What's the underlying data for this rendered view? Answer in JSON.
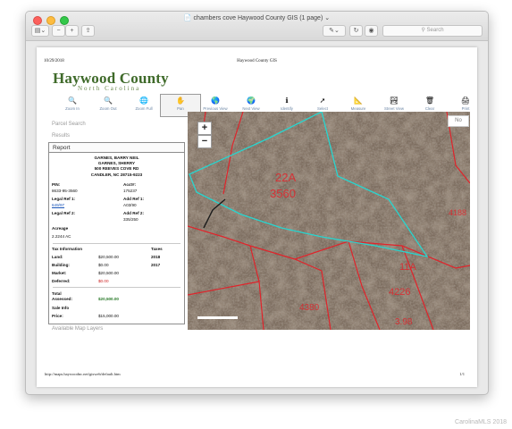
{
  "window": {
    "title": "chambers cove Haywood County GIS (1 page)",
    "search_placeholder": "Search"
  },
  "toolbar_icons": [
    "sidebar-icon",
    "zoom-out-icon",
    "zoom-in-icon",
    "share-icon",
    "markup-icon",
    "rotate-icon",
    "annotate-icon"
  ],
  "page": {
    "date": "10/29/2018",
    "header_title": "Haywood County GIS",
    "footer_url": "http://maps.haywoodnc.net/gisweb/default.htm",
    "page_number": "1/1"
  },
  "logo": {
    "main": "Haywood County",
    "sub": "North Carolina"
  },
  "tools": [
    {
      "label": "Zoom In",
      "icon": "zoom-in-icon",
      "glyph": "🔍"
    },
    {
      "label": "Zoom Out",
      "icon": "zoom-out-icon",
      "glyph": "🔍"
    },
    {
      "label": "Zoom Full",
      "icon": "globe-icon",
      "glyph": "🌐"
    },
    {
      "label": "Pan",
      "icon": "hand-icon",
      "glyph": "✋",
      "active": true
    },
    {
      "label": "Previous View",
      "icon": "previous-view-icon",
      "glyph": "🌎"
    },
    {
      "label": "Next View",
      "icon": "next-view-icon",
      "glyph": "🌍"
    },
    {
      "label": "Identify",
      "icon": "identify-icon",
      "glyph": "ℹ"
    },
    {
      "label": "Select",
      "icon": "select-icon",
      "glyph": "➚"
    },
    {
      "label": "Measure",
      "icon": "measure-icon",
      "glyph": "📐"
    },
    {
      "label": "Street View",
      "icon": "street-view-icon",
      "glyph": "🏞"
    },
    {
      "label": "Clear",
      "icon": "clear-icon",
      "glyph": "🗑"
    },
    {
      "label": "Print",
      "icon": "print-icon",
      "glyph": "🖨"
    }
  ],
  "sidebar": {
    "parcel_search": "Parcel Search",
    "results": "Results",
    "report_tab": "Report",
    "available_layers": "Available Map Layers"
  },
  "report": {
    "owner_1": "GARNES, BARRY NEIL",
    "owner_2": "GARNES, SHERRY",
    "address": "500 REEVES COVE RD",
    "city": "CANDLER, NC 28715-9223",
    "pin_label": "PIN:",
    "pin": "8633-95-3560",
    "acct_label": "Acct#:",
    "acct": "175237",
    "legal_ref1_label": "Legal Ref 1:",
    "legal_ref1": "649/97",
    "add_ref1_label": "Add Ref 1:",
    "add_ref1": "A03/90",
    "legal_ref2_label": "Legal Ref 2:",
    "add_ref2_label": "Add Ref 2:",
    "add_ref2": "335/250",
    "acreage_label": "Acreage",
    "acreage": "2.2244 AC",
    "tax_info_label": "Tax Information",
    "taxes_label": "Taxes",
    "land_label": "Land:",
    "land": "$20,500.00",
    "year_1": "2018",
    "building_label": "Building:",
    "building": "$0.00",
    "year_2": "2017",
    "market_label": "Market:",
    "market": "$20,500.00",
    "deferred_label": "Deferred:",
    "deferred": "$0.00",
    "total_label_1": "Total",
    "total_label_2": "Assessed:",
    "total": "$20,500.00",
    "sale_info_label": "Sale Info",
    "price_label": "Price:",
    "price": "$15,000.00"
  },
  "map": {
    "zoom_in": "+",
    "zoom_out": "−",
    "no_button": "No",
    "labels": [
      {
        "text": "22A",
        "name": "parcel-label-22a"
      },
      {
        "text": "3560",
        "name": "parcel-label-3560"
      },
      {
        "text": "11A",
        "name": "parcel-label-11a"
      },
      {
        "text": "4226",
        "name": "parcel-label-4226"
      },
      {
        "text": "4380",
        "name": "parcel-label-4380"
      },
      {
        "text": "4188",
        "name": "parcel-label-4188"
      },
      {
        "text": "3.98",
        "name": "parcel-label-398"
      }
    ],
    "parcel_color": "#27d6d0",
    "line_color": "#e0242b"
  },
  "watermark": "CarolinaMLS 2018"
}
